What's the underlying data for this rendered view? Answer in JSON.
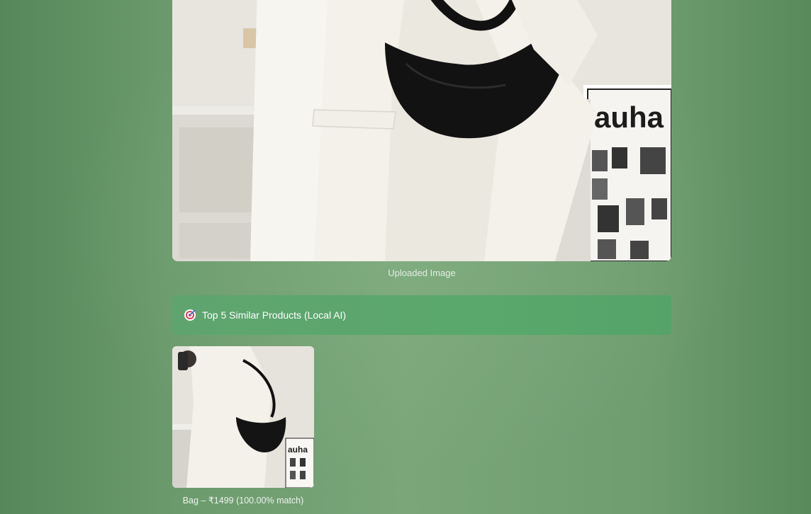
{
  "uploaded": {
    "caption": "Uploaded Image",
    "image_alt": "Person in white blazer carrying black half-moon shoulder bag"
  },
  "results": {
    "icon": "target-icon",
    "title": "Top 5 Similar Products (Local AI)",
    "products": [
      {
        "caption": "Bag – ₹1499 (100.00% match)",
        "image_alt": "Black shoulder bag product photo"
      }
    ]
  },
  "colors": {
    "header_bg": "#5aa86c",
    "page_bg": "#6f9d70"
  }
}
